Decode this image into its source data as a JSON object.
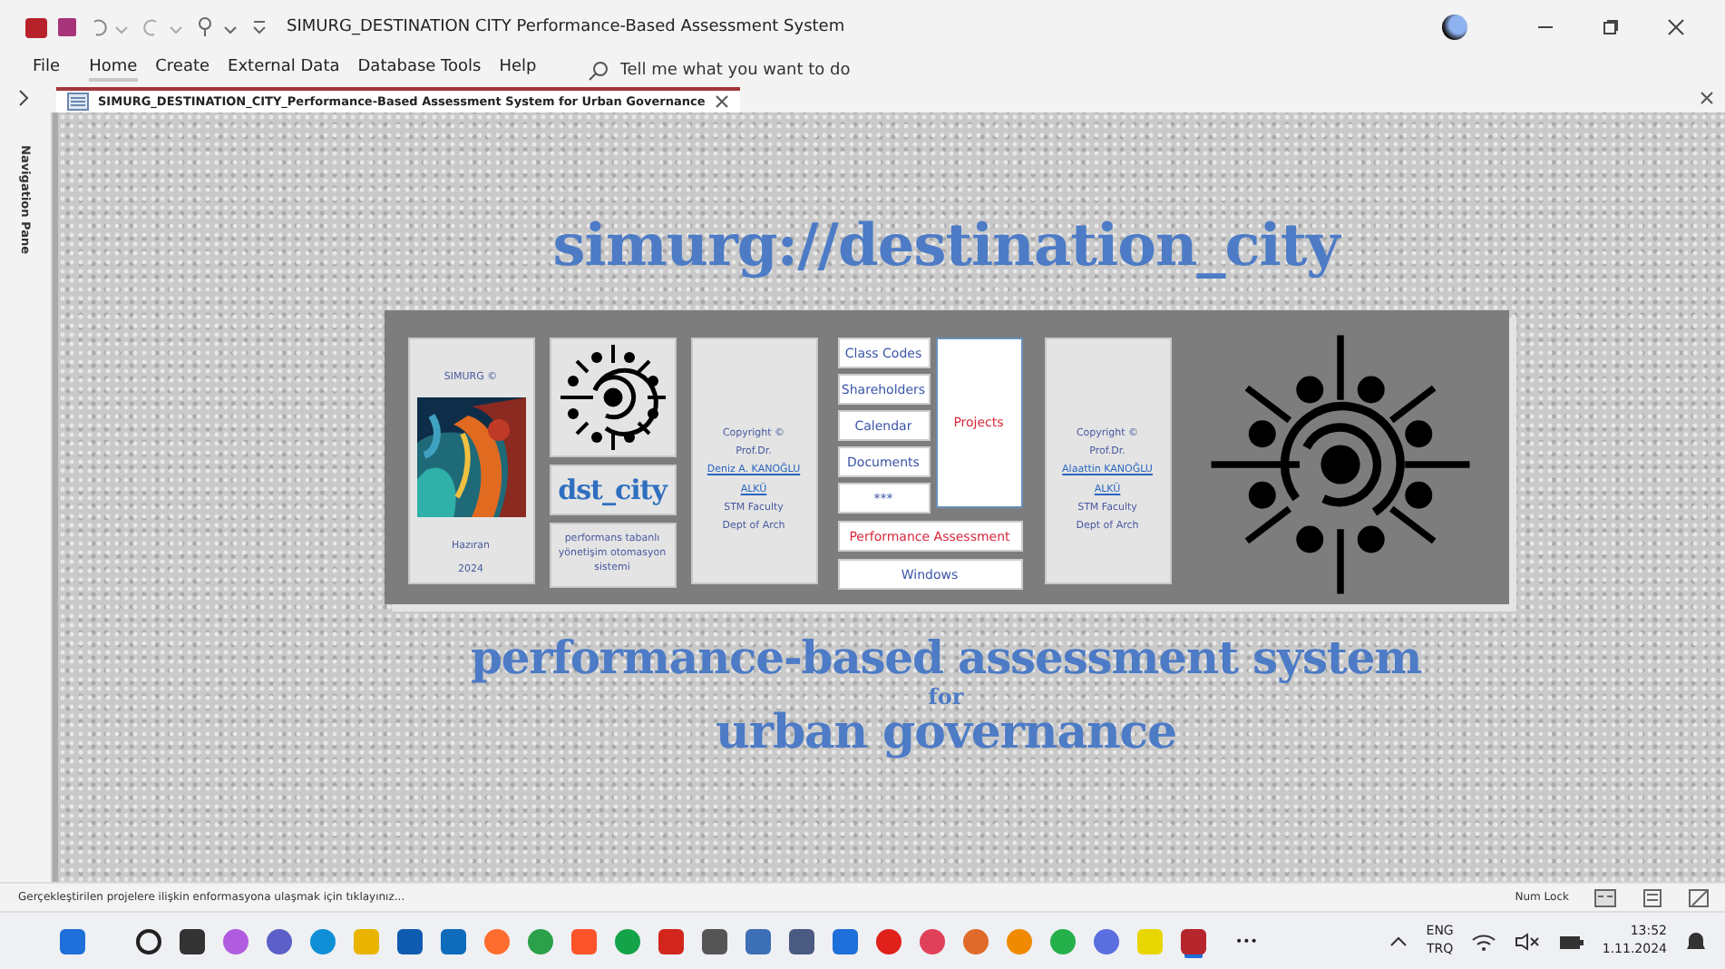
{
  "window": {
    "title": "SIMURG_DESTINATION CITY Performance-Based Assessment System"
  },
  "menu": [
    {
      "label": "File",
      "selected": false
    },
    {
      "label": "Home",
      "selected": true
    },
    {
      "label": "Create",
      "selected": false
    },
    {
      "label": "External Data",
      "selected": false
    },
    {
      "label": "Database Tools",
      "selected": false
    },
    {
      "label": "Help",
      "selected": false
    }
  ],
  "search": {
    "placeholder": "Tell me what you want to do"
  },
  "document_tab": {
    "title": "SIMURG_DESTINATION_CITY_Performance-Based Assessment System for Urban Governance"
  },
  "navigation_pane": {
    "label": "Navigation Pane"
  },
  "form": {
    "heading": "simurg://destination_city",
    "card_left": {
      "title": "SIMURG  ©",
      "lines": [
        "Hazıran",
        "2024"
      ],
      "image": {
        "kind": "picture"
      }
    },
    "logo_card": {
      "name": "dst_city",
      "caption": "performans tabanlı yönetişim otomasyon sistemi"
    },
    "credit_cards": [
      {
        "copyright": "Copyright ©",
        "title": "Prof.Dr.",
        "links": [
          "Deniz A. KANOĞLU",
          "ALKÜ"
        ],
        "lines": [
          "STM Faculty",
          "Dept of Arch"
        ]
      },
      {
        "copyright": "Copyright ©",
        "title": "Prof.Dr.",
        "links": [
          "Alaattin KANOĞLU",
          "ALKÜ"
        ],
        "lines": [
          "STM Faculty",
          "Dept of Arch"
        ]
      }
    ],
    "buttons": [
      {
        "label": "Class Codes",
        "highlighted": false
      },
      {
        "label": "Shareholders",
        "highlighted": false
      },
      {
        "label": "Calendar",
        "highlighted": false
      },
      {
        "label": "Documents",
        "highlighted": false
      },
      {
        "label": "***",
        "highlighted": false
      }
    ],
    "projects_button": {
      "label": "Projects",
      "highlighted": true
    },
    "wide_buttons": [
      {
        "label": "Performance Assessment",
        "highlighted": true
      },
      {
        "label": "Windows",
        "highlighted": false
      }
    ],
    "subtitle": [
      "performance-based assessment system",
      "for",
      "urban governance"
    ]
  },
  "status_bar": {
    "message": "Gerçekleştirilen projelere ilişkin enformasyona ulaşmak için tıklayınız...",
    "indicator": "Num Lock"
  },
  "taskbar": {
    "language": [
      "ENG",
      "TRQ"
    ],
    "time": "13:52",
    "date": "1.11.2024",
    "more": "•••"
  }
}
